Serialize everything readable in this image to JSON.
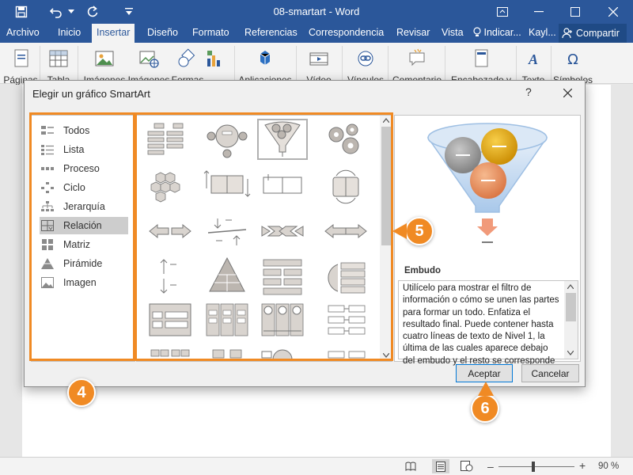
{
  "window": {
    "doc_title": "08-smartart  -  Word"
  },
  "ribbon_tabs": [
    "Archivo",
    "Inicio",
    "Insertar",
    "Diseño",
    "Formato",
    "Referencias",
    "Correspondencia",
    "Revisar",
    "Vista"
  ],
  "active_tab": "Insertar",
  "tell_me": "Indicar...",
  "user_name": "Kayl...",
  "share_label": "Compartir",
  "ribbon_buttons": [
    "Páginas",
    "Tabla",
    "Imágenes",
    "Imágenes",
    "Formas",
    "Aplicaciones",
    "Vídeo",
    "Vínculos",
    "Comentario",
    "Encabezado y",
    "Texto",
    "Símbolos"
  ],
  "dialog": {
    "title": "Elegir un gráfico SmartArt",
    "help": "?",
    "categories": [
      "Todos",
      "Lista",
      "Proceso",
      "Ciclo",
      "Jerarquía",
      "Relación",
      "Matriz",
      "Pirámide",
      "Imagen"
    ],
    "selected_category": "Relación",
    "preview_name": "Embudo",
    "preview_description": "Utilícelo para mostrar el filtro de información o cómo se unen las partes para formar un todo. Enfatiza el resultado final. Puede contener hasta cuatro líneas de texto de Nivel 1, la última de las cuales aparece debajo del embudo y el resto se corresponde",
    "ok_label": "Aceptar",
    "cancel_label": "Cancelar"
  },
  "markers": {
    "m4": "4",
    "m5": "5",
    "m6": "6"
  },
  "status": {
    "zoom": "90 %"
  },
  "colors": {
    "word_blue": "#2b579a",
    "highlight_orange": "#f08a24"
  }
}
